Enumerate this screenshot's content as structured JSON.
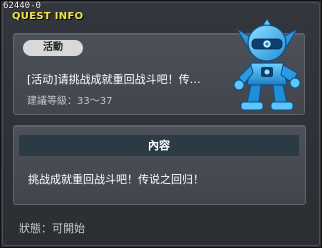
{
  "window": {
    "id_text": "62440-0",
    "title": "QUEST INFO"
  },
  "quest": {
    "tag": "活動",
    "name": "[活动]请挑战成就重回战斗吧！传…",
    "level_line": "建議等級：33～37"
  },
  "content_section": {
    "header": "內容",
    "text": "挑战成就重回战斗吧！传说之回归！"
  },
  "status": {
    "line": "狀態：可開始"
  },
  "colors": {
    "title": "#f2e24d",
    "window_bg": "#2d3036",
    "panel_bg": "#4c5058",
    "header_bg": "#2b3a45",
    "mascot_primary": "#2fa8ea"
  },
  "icons": {
    "mascot": "blue-robot-mascot-icon"
  }
}
